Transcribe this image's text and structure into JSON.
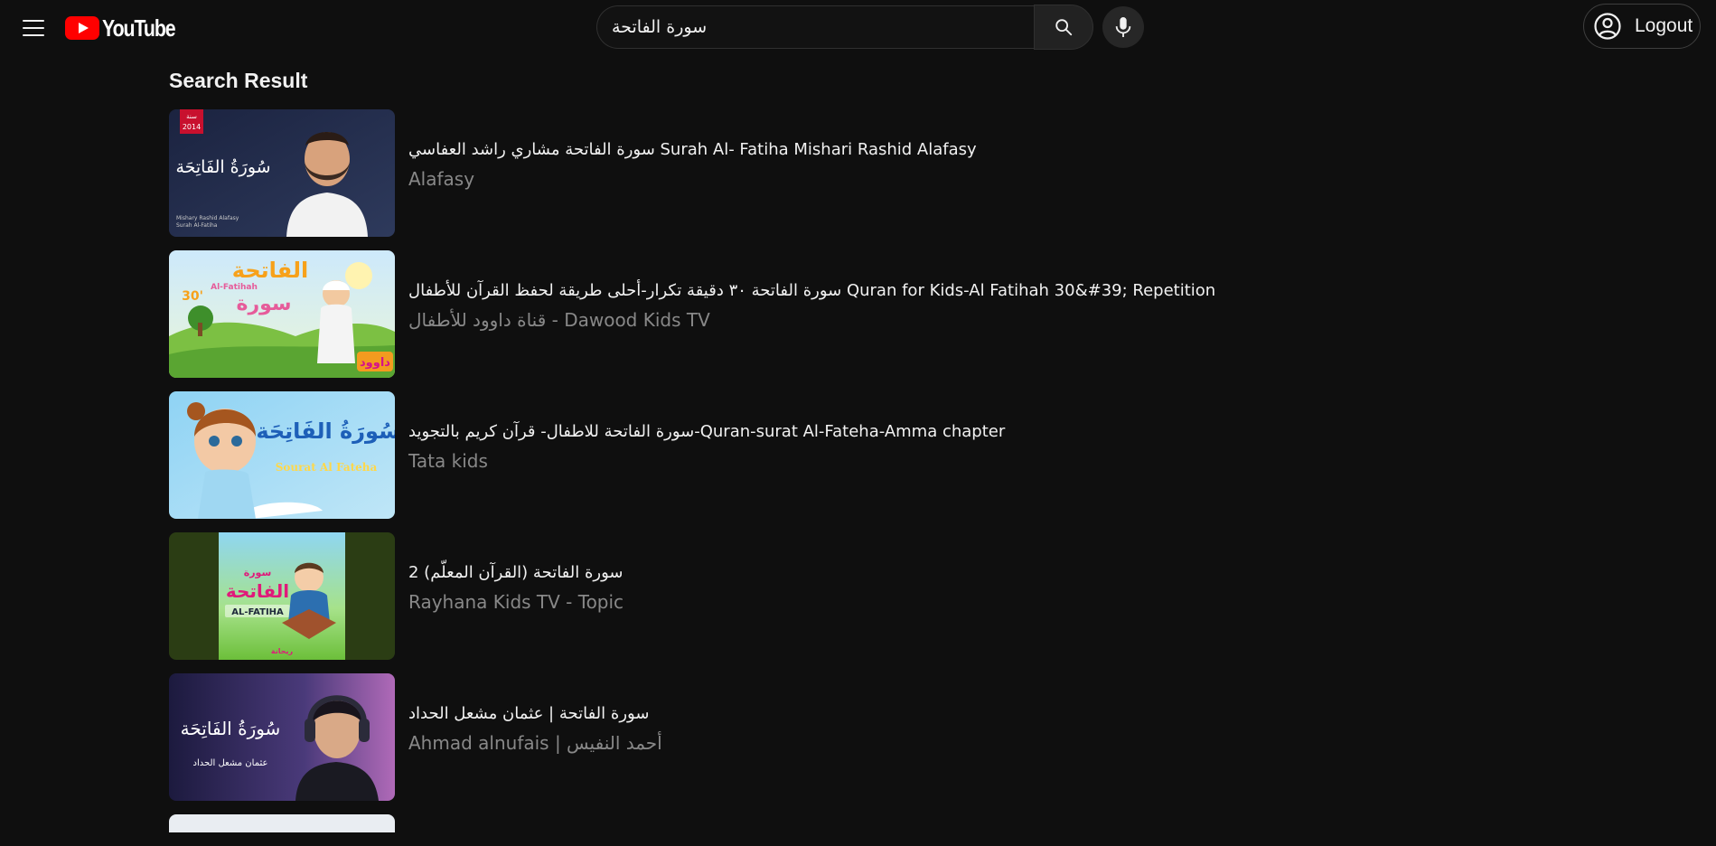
{
  "header": {
    "logo_text": "YouTube",
    "search_value": "سورة الفاتحة",
    "logout_label": "Logout"
  },
  "main": {
    "section_title": "Search Result",
    "results": [
      {
        "title": "سورة الفاتحة مشاري راشد العفاسي Surah Al- Fatiha Mishari Rashid Alafasy",
        "channel": "Alafasy"
      },
      {
        "title": "سورة الفاتحة ٣٠ دقيقة تكرار-أحلى طريقة لحفظ القرآن للأطفال Quran for Kids-Al Fatihah 30&#39; Repetition",
        "channel": "قناة داوود للأطفال - Dawood Kids TV"
      },
      {
        "title": "سورة الفاتحة للاطفال- قرآن كريم بالتجويد-Quran-surat Al-Fateha-Amma chapter",
        "channel": "Tata kids"
      },
      {
        "title": "سورة الفاتحة (القرآن المعلّم) 2",
        "channel": "Rayhana Kids TV - Topic"
      },
      {
        "title": "سورة الفاتحة | عثمان مشعل الحداد",
        "channel": "Ahmad alnufais | أحمد النفيس"
      }
    ]
  },
  "thumbnails": [
    {
      "badge_top": "سنة",
      "badge_year": "2014",
      "arabic": "سُورَةُ الفَاتِحَة",
      "caption_1": "Mishary Rashid Alafasy",
      "caption_2": "Surah Al-Fatiha"
    },
    {
      "arabic_1": "الفاتحة",
      "arabic_2": "سورة",
      "latin": "Al-Fatihah",
      "badge": "30'",
      "brand": "داوود"
    },
    {
      "arabic": "سُورَةُ الفَاتِحَة",
      "latin": "Sourat Al Fateha"
    },
    {
      "arabic_1": "سورة",
      "arabic_2": "الفاتحة",
      "latin": "AL-FATIHA",
      "brand": "ريحانة"
    },
    {
      "arabic": "سُورَةُ الفَاتِحَة",
      "caption": "عثمان مشعل الحداد"
    }
  ],
  "colors": {
    "background": "#0f0f0f",
    "logo_red": "#ff0000",
    "text_primary": "#f1f1f1",
    "text_secondary": "#888888"
  },
  "icons": [
    "menu-icon",
    "youtube-play-icon",
    "search-icon",
    "microphone-icon",
    "user-circle-icon"
  ]
}
